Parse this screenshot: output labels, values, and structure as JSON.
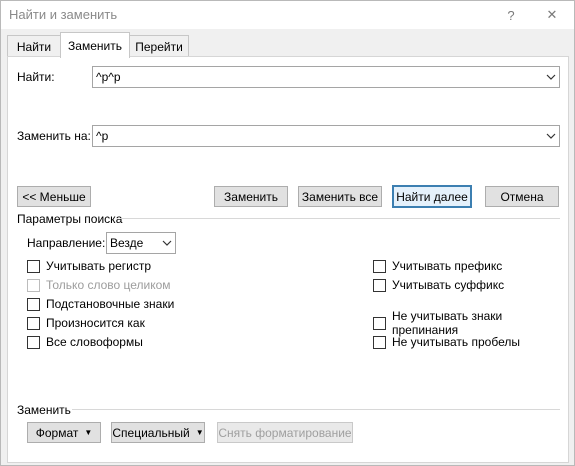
{
  "window": {
    "title": "Найти и заменить",
    "help": "?",
    "close": "✕"
  },
  "tabs": [
    {
      "label": "Найти"
    },
    {
      "label": "Заменить"
    },
    {
      "label": "Перейти"
    }
  ],
  "find": {
    "label": "Найти:",
    "value": "^p^p"
  },
  "replace": {
    "label": "Заменить на:",
    "value": "^p"
  },
  "buttons": {
    "less": "<< Меньше",
    "replace": "Заменить",
    "replace_all": "Заменить все",
    "find_next": "Найти далее",
    "cancel": "Отмена"
  },
  "search_options": {
    "heading": "Параметры поиска",
    "direction_label": "Направление:",
    "direction_value": "Везде",
    "left": [
      {
        "label": "Учитывать регистр",
        "checked": false,
        "enabled": true
      },
      {
        "label": "Только слово целиком",
        "checked": false,
        "enabled": false
      },
      {
        "label": "Подстановочные знаки",
        "checked": false,
        "enabled": true
      },
      {
        "label": "Произносится как",
        "checked": false,
        "enabled": true
      },
      {
        "label": "Все словоформы",
        "checked": false,
        "enabled": true
      }
    ],
    "right": [
      {
        "label": "Учитывать префикс",
        "checked": false,
        "enabled": true
      },
      {
        "label": "Учитывать суффикс",
        "checked": false,
        "enabled": true
      },
      {
        "label": "Не учитывать знаки препинания",
        "checked": false,
        "enabled": true
      },
      {
        "label": "Не учитывать пробелы",
        "checked": false,
        "enabled": true
      }
    ]
  },
  "replace_section": {
    "heading": "Заменить",
    "format": "Формат",
    "special": "Специальный",
    "clear_format": "Снять форматирование"
  },
  "icons": {
    "dropdown": "chevron-down-icon",
    "close": "close-icon",
    "help": "help-icon",
    "caret": "caret-down-icon"
  }
}
